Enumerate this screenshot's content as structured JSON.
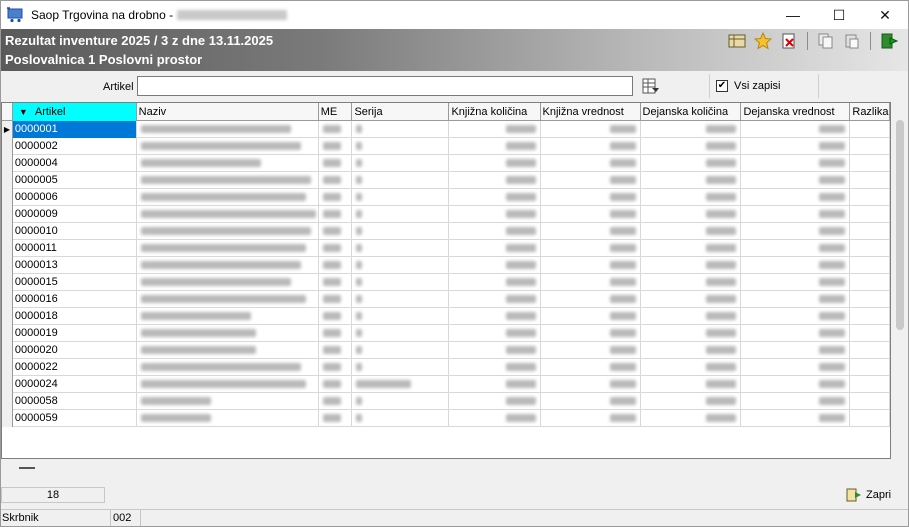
{
  "window": {
    "title": "Saop Trgovina na drobno -",
    "controls": {
      "minimize": "—",
      "maximize": "☐",
      "close": "✕"
    }
  },
  "header": {
    "title": "Rezultat inventure 2025 / 3  z dne 13.11.2025",
    "subtitle": "Poslovalnica 1 Poslovni prostor",
    "toolbar_icons": [
      "columns-icon",
      "favorite-star-icon",
      "delete-icon",
      "copy-icon",
      "paste-icon",
      "exit-icon"
    ]
  },
  "filter": {
    "artikel_label": "Artikel",
    "artikel_value": "",
    "vsi_zapisi_label": "Vsi zapisi",
    "vsi_zapisi_checked": "✔"
  },
  "grid": {
    "columns": [
      "Artikel",
      "Naziv",
      "ME",
      "Serija",
      "Knjižna količina",
      "Knjižna vrednost",
      "Dejanska količina",
      "Dejanska vrednost",
      "Razlika"
    ],
    "sort_arrow": "▼",
    "row_indicator": "▶",
    "rows": [
      "0000001",
      "0000002",
      "0000004",
      "0000005",
      "0000006",
      "0000009",
      "0000010",
      "0000011",
      "0000013",
      "0000015",
      "0000016",
      "0000018",
      "0000019",
      "0000020",
      "0000022",
      "0000024",
      "0000058",
      "0000059"
    ],
    "selected_index": 0
  },
  "footer": {
    "count": "18",
    "zapri_label": "Zapri"
  },
  "statusbar": {
    "user": "Skrbnik",
    "code": "002"
  },
  "colors": {
    "active_header": "#00ffff",
    "selection": "#0078d7"
  }
}
